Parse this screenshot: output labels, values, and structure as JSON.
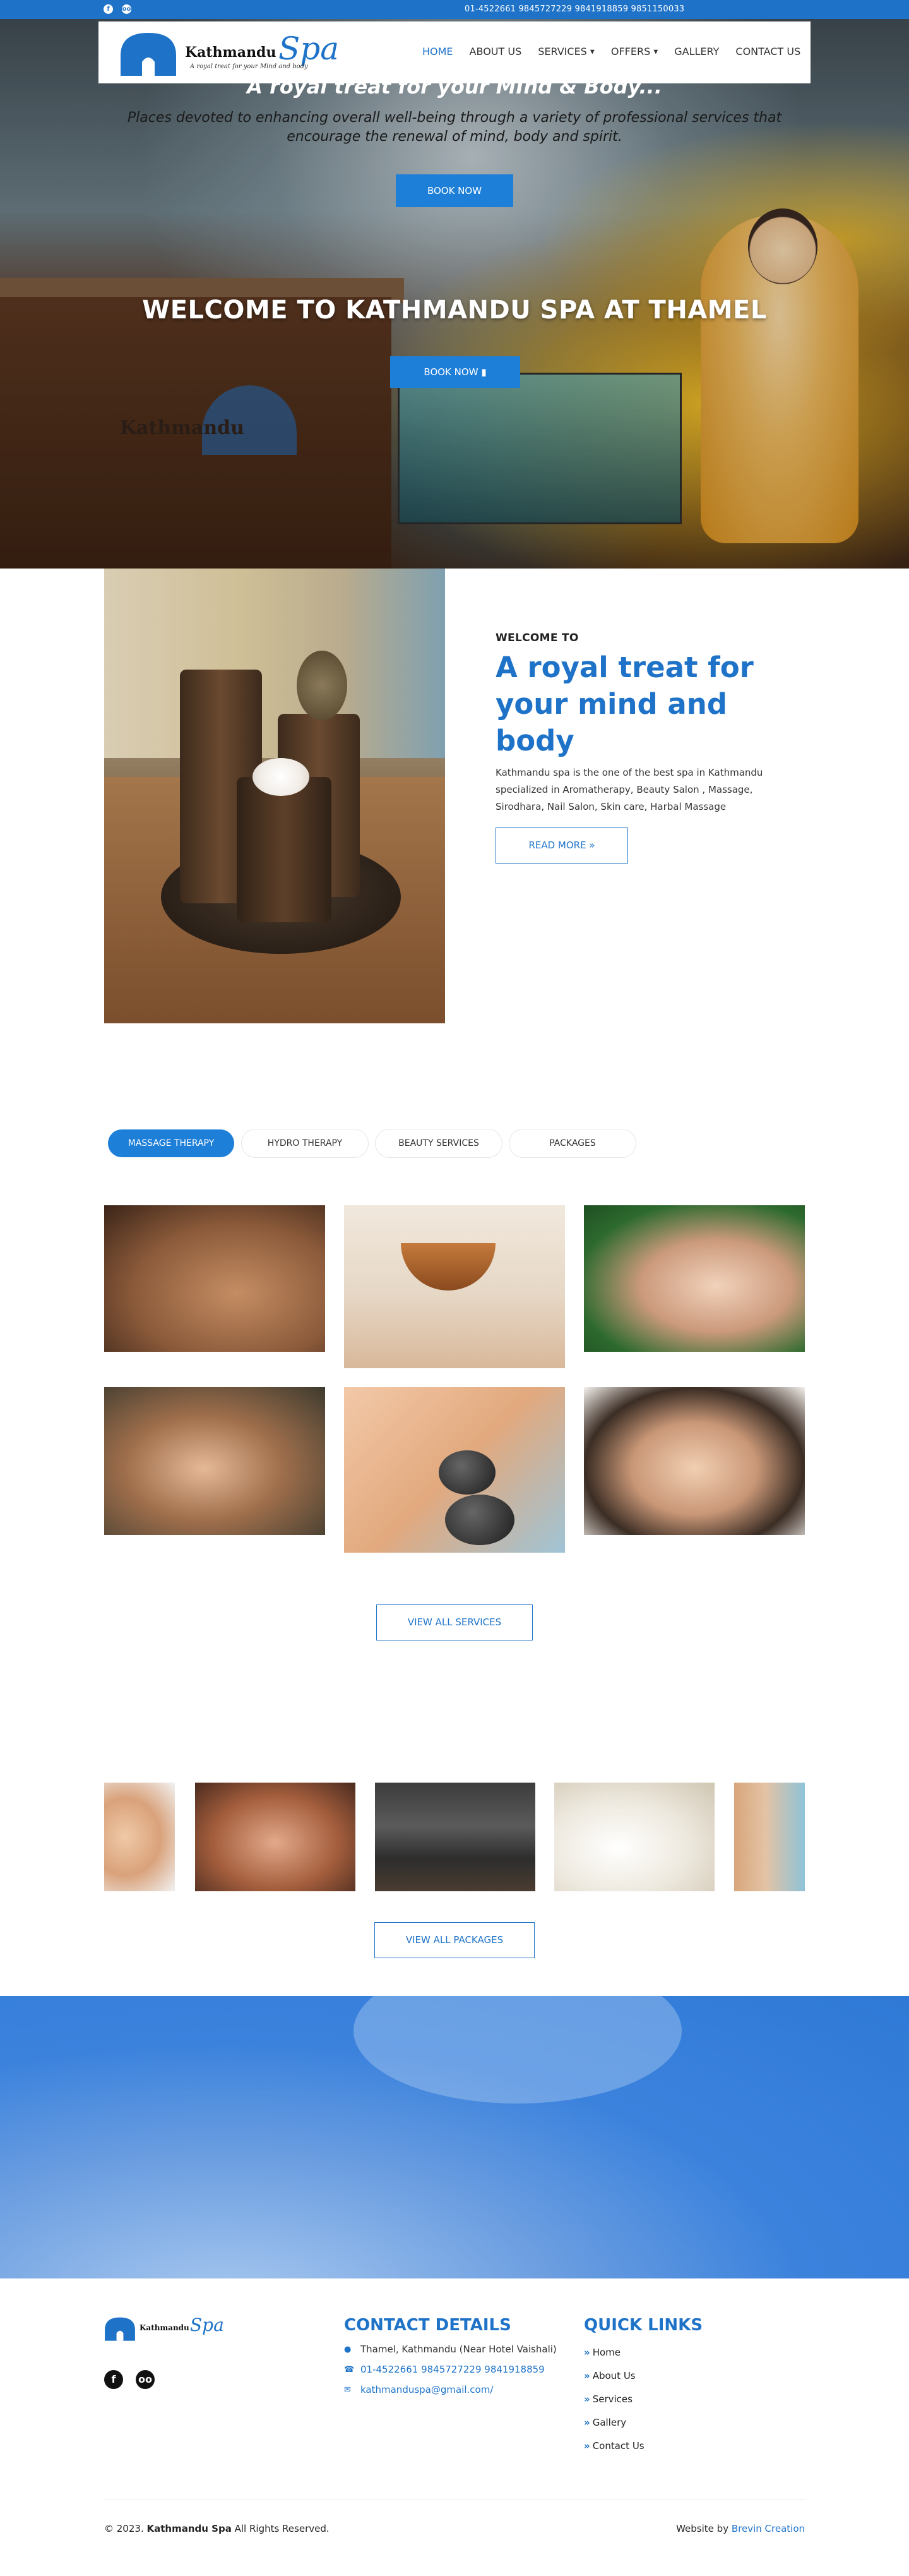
{
  "topbar": {
    "social": [
      "facebook-icon",
      "tripadvisor-icon"
    ],
    "phones": "01-4522661  9845727229  9841918859  9851150033"
  },
  "header": {
    "logo_brand": "Kathmandu",
    "logo_spa": "Spa",
    "logo_tagline": "A royal treat for your Mind and body",
    "nav": [
      "HOME",
      "ABOUT US",
      "SERVICES",
      "OFFERS",
      "GALLERY",
      "CONTACT US"
    ],
    "active_nav": "HOME"
  },
  "hero": {
    "title": "WELCOME TO KATHMANDU SPA AT THAMEL",
    "book_label": "BOOK NOW",
    "watermark_text": "Kathmandu"
  },
  "welcome": {
    "eyebrow": "WELCOME TO",
    "title": "A royal treat for your mind and body",
    "description": "Kathmandu spa is the one of the best spa in Kathmandu specialized in Aromatherapy, Beauty Salon , Massage, Sirodhara, Nail Salon, Skin care, Harbal Massage",
    "read_more": "READ MORE"
  },
  "tabs": {
    "items": [
      "MASSAGE THERAPY",
      "HYDRO THERAPY",
      "BEAUTY SERVICES",
      "PACKAGES"
    ],
    "active": "MASSAGE THERAPY"
  },
  "services": {
    "view_all": "VIEW ALL SERVICES"
  },
  "packages": {
    "view_all": "VIEW ALL PACKAGES"
  },
  "banner": {
    "title": "A royal treat for your MInd & Body...",
    "subtitle": "Places devoted to enhancing overall well-being through a variety of professional services that encourage the renewal of mind, body and spirit.",
    "book_label": "BOOK NOW"
  },
  "footer": {
    "logo_brand": "Kathmandu",
    "logo_spa": "Spa",
    "social": [
      "facebook-icon",
      "tripadvisor-icon"
    ],
    "contact_title": "CONTACT DETAILS",
    "address": "Thamel, Kathmandu (Near Hotel Vaishali)",
    "phones": "01-4522661 9845727229 9841918859",
    "email": "kathmanduspa@gmail.com/",
    "links_title": "QUICK LINKS",
    "links": [
      "Home",
      "About Us",
      "Services",
      "Gallery",
      "Contact Us"
    ],
    "copyright_prefix": "© 2023.",
    "copyright_brand": "Kathmandu Spa",
    "copyright_suffix": "All Rights Reserved.",
    "credit_prefix": "Website by",
    "credit_link": "Brevin Creation"
  },
  "colors": {
    "primary": "#1e73c8",
    "button": "#1e7fd8",
    "banner": "#3b82dd"
  }
}
